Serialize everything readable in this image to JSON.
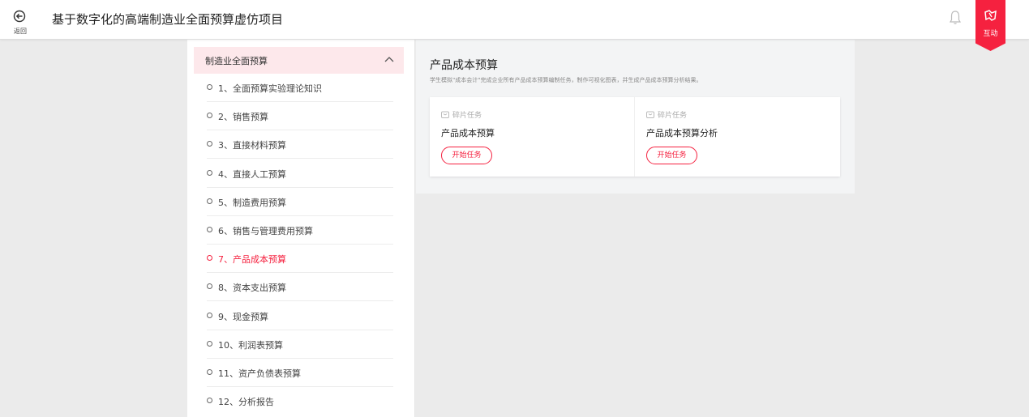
{
  "header": {
    "back_label": "返回",
    "title": "基于数字化的高端制造业全面预算虚仿项目",
    "bell_icon": "bell-icon",
    "interact_label": "互动",
    "accent": "#f5213f"
  },
  "sidebar": {
    "section_title": "制造业全面预算",
    "items": [
      {
        "label": "1、全面预算实验理论知识"
      },
      {
        "label": "2、销售预算"
      },
      {
        "label": "3、直接材料预算"
      },
      {
        "label": "4、直接人工预算"
      },
      {
        "label": "5、制造费用预算"
      },
      {
        "label": "6、销售与管理费用预算"
      },
      {
        "label": "7、产品成本预算"
      },
      {
        "label": "8、资本支出预算"
      },
      {
        "label": "9、现金预算"
      },
      {
        "label": "10、利润表预算"
      },
      {
        "label": "11、资产负债表预算"
      },
      {
        "label": "12、分析报告"
      }
    ],
    "active_index": 6
  },
  "main": {
    "title": "产品成本预算",
    "description": "学生模拟\"成本会计\"完成企业所有产品成本预算编制任务，制作可视化图表，并生成产品成本预算分析结果。",
    "cards": [
      {
        "tag": "碎片任务",
        "name": "产品成本预算",
        "button": "开始任务"
      },
      {
        "tag": "碎片任务",
        "name": "产品成本预算分析",
        "button": "开始任务"
      }
    ]
  }
}
